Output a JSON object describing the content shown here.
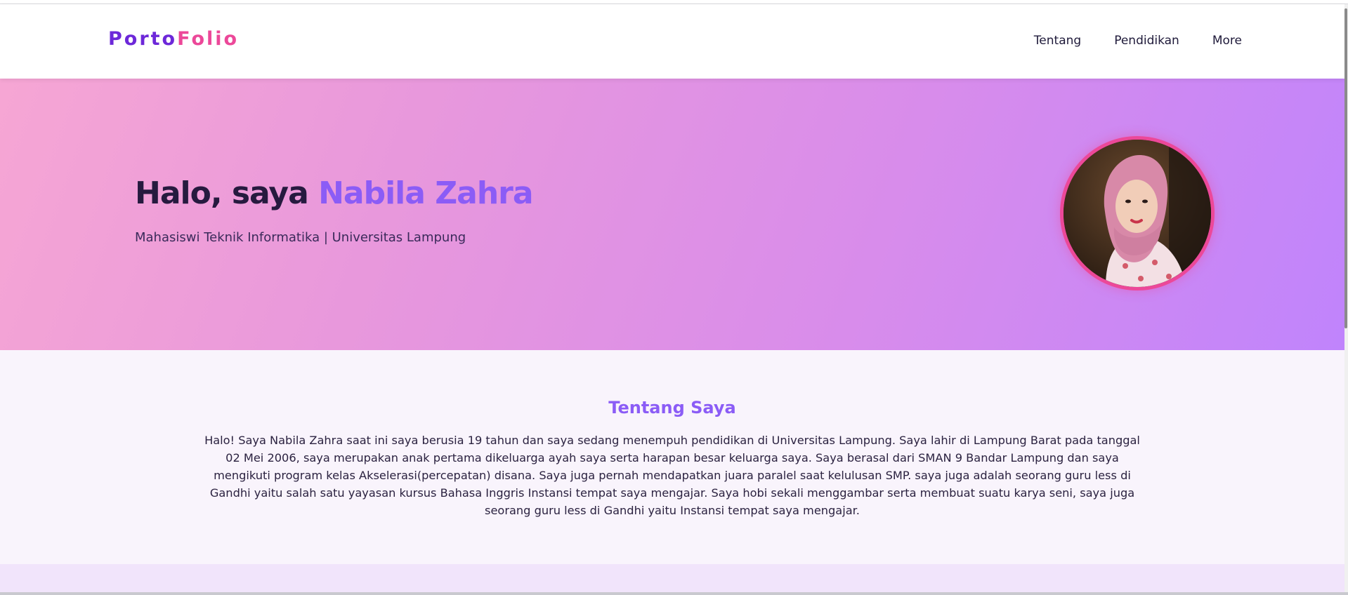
{
  "logo": {
    "part1": "Porto",
    "part2": "Folio"
  },
  "nav": {
    "items": [
      {
        "label": "Tentang"
      },
      {
        "label": "Pendidikan"
      },
      {
        "label": "More"
      }
    ]
  },
  "hero": {
    "greeting": "Halo, saya ",
    "name": "Nabila Zahra",
    "subtitle": "Mahasiswi Teknik Informatika | Universitas Lampung",
    "avatar_icon": "profile-photo"
  },
  "about": {
    "title": "Tentang Saya",
    "body": "Halo! Saya Nabila Zahra saat ini saya berusia 19 tahun dan saya sedang menempuh pendidikan di Universitas Lampung. Saya lahir di Lampung Barat pada tanggal 02 Mei 2006, saya merupakan anak pertama dikeluarga ayah saya serta harapan besar keluarga saya. Saya berasal dari SMAN 9 Bandar Lampung dan saya mengikuti program kelas Akselerasi(percepatan) disana. Saya juga pernah mendapatkan juara paralel saat kelulusan SMP. saya juga adalah seorang guru less di Gandhi yaitu salah satu yayasan kursus Bahasa Inggris Instansi tempat saya mengajar. Saya hobi sekali menggambar serta membuat suatu karya seni, saya juga seorang guru less di Gandhi yaitu Instansi tempat saya mengajar."
  },
  "colors": {
    "accent_purple": "#8b5cf6",
    "logo_purple": "#6d28d9",
    "accent_pink": "#ec4899",
    "hero_gradient_start": "#f6a6d4",
    "hero_gradient_end": "#c084fc"
  }
}
